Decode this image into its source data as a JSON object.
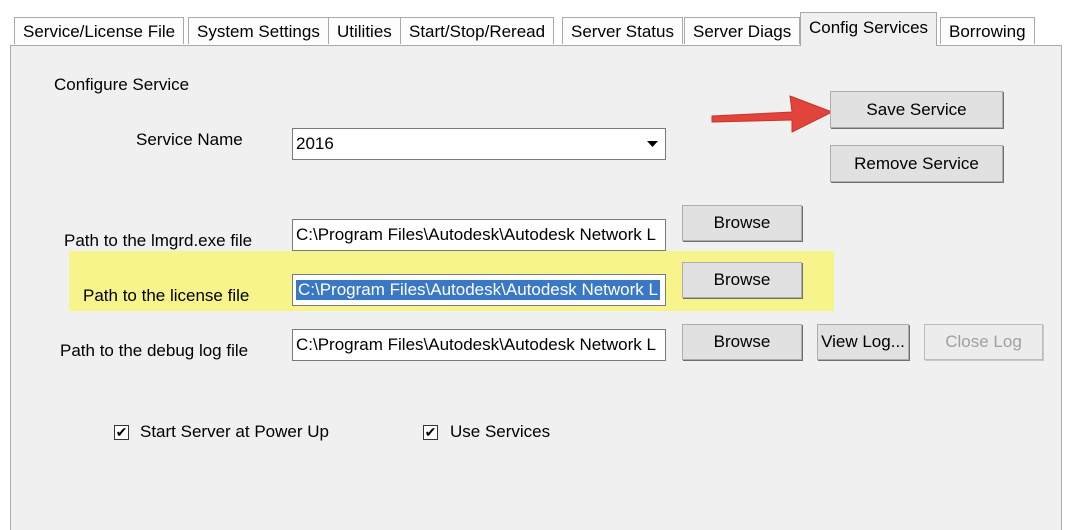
{
  "tabs": [
    {
      "label": "Service/License File"
    },
    {
      "label": "System Settings"
    },
    {
      "label": "Utilities"
    },
    {
      "label": "Start/Stop/Reread"
    },
    {
      "label": "Server Status"
    },
    {
      "label": "Server Diags"
    },
    {
      "label": "Config Services",
      "active": true
    },
    {
      "label": "Borrowing"
    }
  ],
  "section_title": "Configure Service",
  "service": {
    "label": "Service Name",
    "value": "2016",
    "save_label": "Save Service",
    "remove_label": "Remove Service"
  },
  "lmgrd": {
    "label": "Path to the lmgrd.exe file",
    "value": "C:\\Program Files\\Autodesk\\Autodesk Network L",
    "browse_label": "Browse"
  },
  "license": {
    "label": "Path to the license file",
    "value": "C:\\Program Files\\Autodesk\\Autodesk Network L",
    "browse_label": "Browse"
  },
  "debug": {
    "label": "Path to the debug log file",
    "value": "C:\\Program Files\\Autodesk\\Autodesk Network L",
    "browse_label": "Browse",
    "view_log_label": "View Log...",
    "close_log_label": "Close Log"
  },
  "options": {
    "start_server": {
      "label": "Start Server at Power Up",
      "checked": true
    },
    "use_services": {
      "label": "Use Services",
      "checked": true
    }
  },
  "colors": {
    "highlight": "#f6f48a",
    "arrow": "#e0443a",
    "selection": "#3a78c6"
  },
  "icons": {
    "annotation": "red-arrow-icon",
    "dropdown": "chevron-down-icon",
    "check": "checkmark-icon"
  }
}
